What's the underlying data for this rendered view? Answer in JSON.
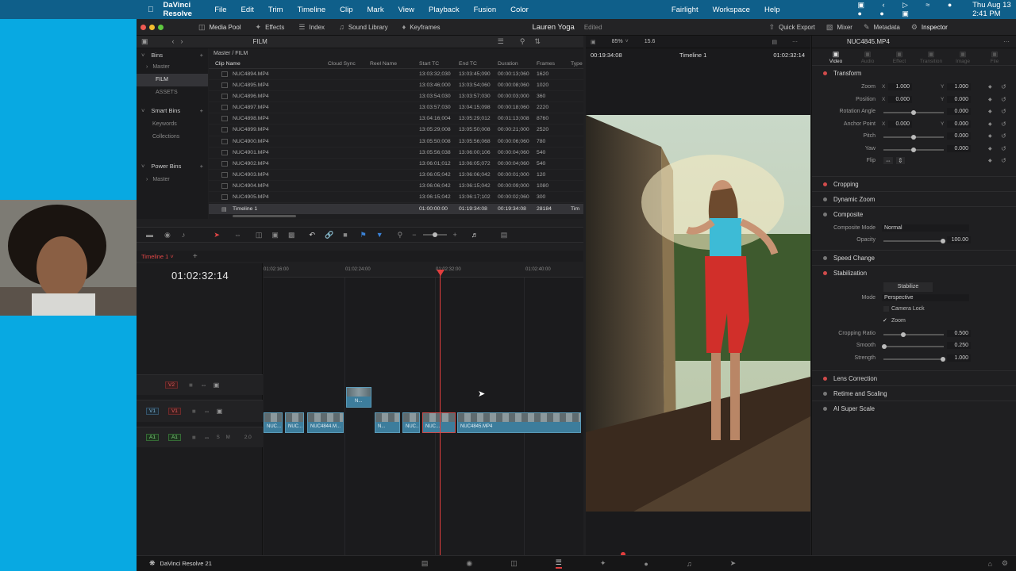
{
  "menubar": {
    "app": "DaVinci Resolve",
    "items": [
      "File",
      "Edit",
      "Trim",
      "Timeline",
      "Clip",
      "Mark",
      "View",
      "Playback",
      "Fusion",
      "Color",
      "Fairlight",
      "Workspace",
      "Help"
    ],
    "clock": "Thu Aug 13  2:41 PM"
  },
  "toolbar": {
    "media_pool": "Media Pool",
    "effects": "Effects",
    "index": "Index",
    "sound_library": "Sound Library",
    "keyframes": "Keyframes",
    "project_title": "Lauren Yoga",
    "project_status": "Edited",
    "quick_export": "Quick Export",
    "mixer": "Mixer",
    "metadata": "Metadata",
    "inspector": "Inspector"
  },
  "media_pool": {
    "bin_name": "FILM",
    "bins_label": "Bins",
    "bins": [
      "Master",
      "FILM",
      "ASSETS"
    ],
    "smart_bins_label": "Smart Bins",
    "smart_bins": [
      "Keywords",
      "Collections"
    ],
    "power_bins_label": "Power Bins",
    "power_bins": [
      "Master"
    ],
    "breadcrumb": "Master / FILM",
    "columns": [
      "Clip Name",
      "Cloud Sync",
      "Reel Name",
      "Start TC",
      "End TC",
      "Duration",
      "Frames",
      "Type"
    ],
    "clips": [
      {
        "name": "NUC4894.MP4",
        "start": "13:03:32;030",
        "end": "13:03:45;090",
        "dur": "00:00:13;060",
        "frames": "1620"
      },
      {
        "name": "NUC4895.MP4",
        "start": "13:03:46;000",
        "end": "13:03:54;060",
        "dur": "00:00:08;060",
        "frames": "1020"
      },
      {
        "name": "NUC4896.MP4",
        "start": "13:03:54;030",
        "end": "13:03:57;030",
        "dur": "00:00:03;000",
        "frames": "360"
      },
      {
        "name": "NUC4897.MP4",
        "start": "13:03:57;030",
        "end": "13:04:15;098",
        "dur": "00:00:18;060",
        "frames": "2220"
      },
      {
        "name": "NUC4898.MP4",
        "start": "13:04:16;004",
        "end": "13:05:29;012",
        "dur": "00:01:13;008",
        "frames": "8760"
      },
      {
        "name": "NUC4899.MP4",
        "start": "13:05:29;008",
        "end": "13:05:50;008",
        "dur": "00:00:21;000",
        "frames": "2520"
      },
      {
        "name": "NUC4900.MP4",
        "start": "13:05:50;008",
        "end": "13:05:56;068",
        "dur": "00:00:06;060",
        "frames": "780"
      },
      {
        "name": "NUC4901.MP4",
        "start": "13:05:56;038",
        "end": "13:06:00;106",
        "dur": "00:00:04;060",
        "frames": "540"
      },
      {
        "name": "NUC4902.MP4",
        "start": "13:06:01;012",
        "end": "13:06:05;072",
        "dur": "00:00:04;060",
        "frames": "540"
      },
      {
        "name": "NUC4903.MP4",
        "start": "13:06:05;042",
        "end": "13:06:06;042",
        "dur": "00:00:01;000",
        "frames": "120"
      },
      {
        "name": "NUC4904.MP4",
        "start": "13:06:06;042",
        "end": "13:06:15;042",
        "dur": "00:00:09;000",
        "frames": "1080"
      },
      {
        "name": "NUC4905.MP4",
        "start": "13:06:15;042",
        "end": "13:06:17;102",
        "dur": "00:00:02;060",
        "frames": "300"
      }
    ],
    "timeline_row": {
      "name": "Timeline 1",
      "start": "01:00:00:00",
      "end": "01:19:34:08",
      "dur": "00:19:34:08",
      "frames": "28184",
      "type": "Tim"
    }
  },
  "timeline": {
    "tab": "Timeline 1",
    "timecode": "01:02:32:14",
    "ruler": [
      "01:02:16:00",
      "01:02:24:00",
      "01:02:32:00",
      "01:02:40:00"
    ],
    "tracks": [
      {
        "id": "V2",
        "label": "V2"
      },
      {
        "id": "V1",
        "label": "V1",
        "src": "V1"
      },
      {
        "id": "A1",
        "label": "A1",
        "src": "A1",
        "level": "2.0"
      }
    ],
    "clip_labels": [
      "NUC...",
      "NUC...",
      "NUC4844.M...",
      "N...",
      "N...",
      "NUC...",
      "NUC...",
      "NUC4845.MP4",
      "N..."
    ]
  },
  "viewer": {
    "zoom": "85%",
    "fps": "15.6",
    "source_tc": "00:19:34:08",
    "timeline_name": "Timeline 1",
    "record_tc": "01:02:32:14"
  },
  "inspector": {
    "clip_name": "NUC4845.MP4",
    "tabs": [
      "Video",
      "Audio",
      "Effect",
      "Transition",
      "Image",
      "File"
    ],
    "transform": {
      "title": "Transform",
      "zoom_label": "Zoom",
      "zoom_x": "1.000",
      "zoom_y": "1.000",
      "position_label": "Position",
      "position_x": "0.000",
      "position_y": "0.000",
      "rotation_label": "Rotation Angle",
      "rotation": "0.000",
      "anchor_label": "Anchor Point",
      "anchor_x": "0.000",
      "anchor_y": "0.000",
      "pitch_label": "Pitch",
      "pitch": "0.000",
      "yaw_label": "Yaw",
      "yaw": "0.000",
      "flip_label": "Flip"
    },
    "cropping": "Cropping",
    "dynamic_zoom": "Dynamic Zoom",
    "composite": {
      "title": "Composite",
      "mode_label": "Composite Mode",
      "mode": "Normal",
      "opacity_label": "Opacity",
      "opacity": "100.00"
    },
    "speed_change": "Speed Change",
    "stabilization": {
      "title": "Stabilization",
      "button": "Stabilize",
      "mode_label": "Mode",
      "mode": "Perspective",
      "camera_lock": "Camera Lock",
      "zoom": "Zoom",
      "crop_ratio_label": "Cropping Ratio",
      "crop_ratio": "0.500",
      "smooth_label": "Smooth",
      "smooth": "0.250",
      "strength_label": "Strength",
      "strength": "1.000"
    },
    "lens_correction": "Lens Correction",
    "retime": "Retime and Scaling",
    "super_scale": "AI Super Scale"
  },
  "footer": {
    "app_name": "DaVinci Resolve 21"
  },
  "colors": {
    "accent": "#e03c3c",
    "clip_blue": "#3d7d9c",
    "selection": "#c94b4b"
  }
}
